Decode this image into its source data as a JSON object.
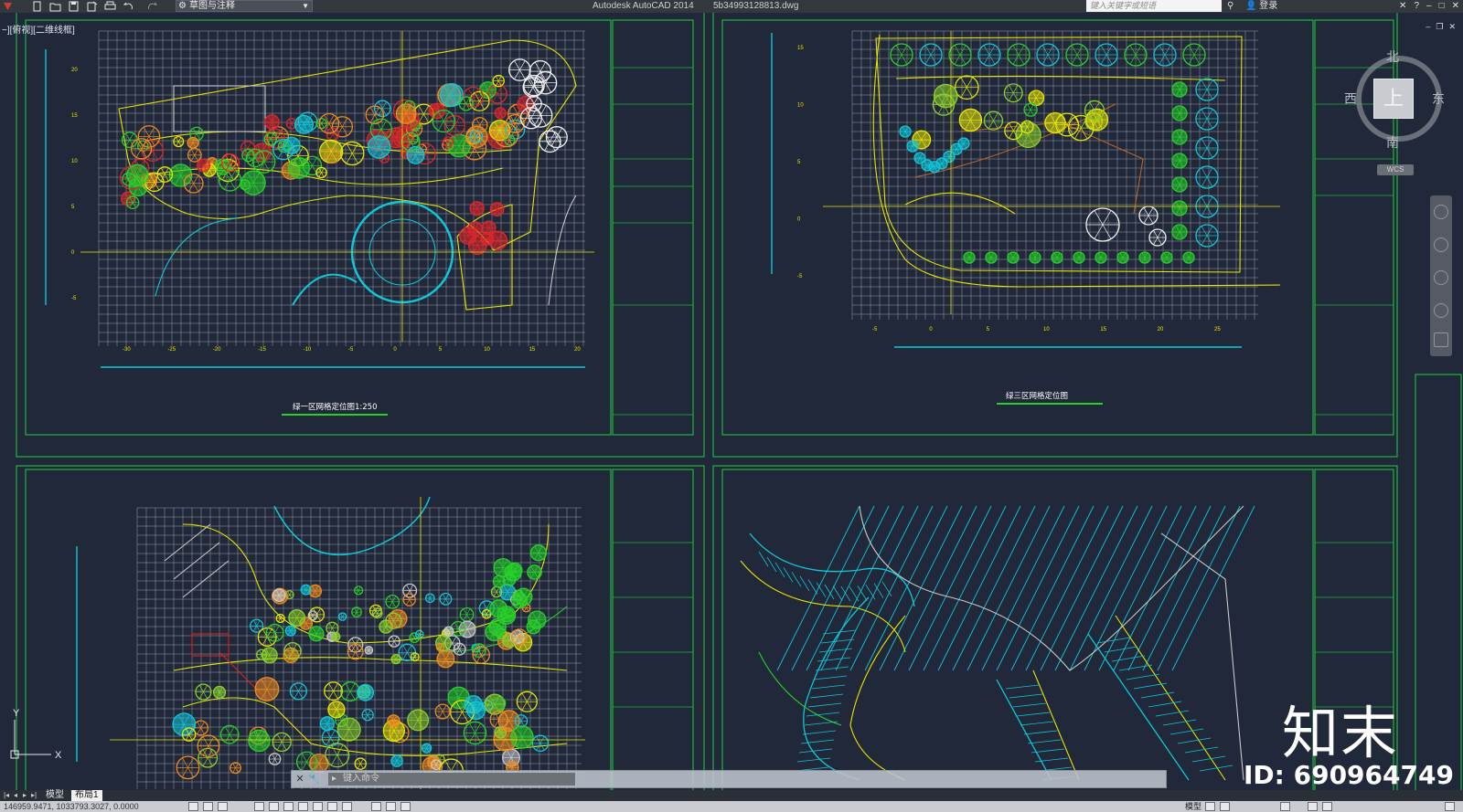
{
  "app": {
    "name": "Autodesk AutoCAD 2014",
    "document": "5b34993128813.dwg",
    "workspace": "草图与注释",
    "search_placeholder": "键入关键字或短语",
    "login": "登录"
  },
  "viewport": {
    "label": "−][俯视][二维线框]"
  },
  "viewcube": {
    "north": "北",
    "south": "南",
    "east": "东",
    "west": "西",
    "face": "上",
    "wcs": "WCS"
  },
  "sheets": [
    {
      "title": "绿一区网格定位图1:250",
      "y_ticks": [
        "20",
        "15",
        "10",
        "5",
        "0",
        "-5"
      ],
      "x_ticks": [
        "-30",
        "-25",
        "-20",
        "-15",
        "-10",
        "-5",
        "0",
        "5",
        "10",
        "15",
        "20"
      ]
    },
    {
      "title": "绿三区网格定位图",
      "y_ticks": [
        "15",
        "10",
        "5",
        "0",
        "-5"
      ],
      "x_ticks": [
        "-5",
        "0",
        "5",
        "10",
        "15",
        "20",
        "25"
      ]
    }
  ],
  "command": {
    "placeholder": "键入命令"
  },
  "tabs": {
    "model": "模型",
    "layout1": "布局1"
  },
  "status": {
    "coords": "146959.9471, 1033793.3027, 0.0000",
    "model_label": "模型"
  },
  "watermark": {
    "logo": "知末",
    "id": "ID: 690964749"
  },
  "colors": {
    "background": "#21283a",
    "frame": "#1fb53c",
    "grid": "#ffffff",
    "axis": "#e6e600",
    "cyan": "#10c7d8",
    "tree_green": "#27d12a",
    "tree_red": "#e0262a",
    "tree_orange": "#f08a1e"
  }
}
